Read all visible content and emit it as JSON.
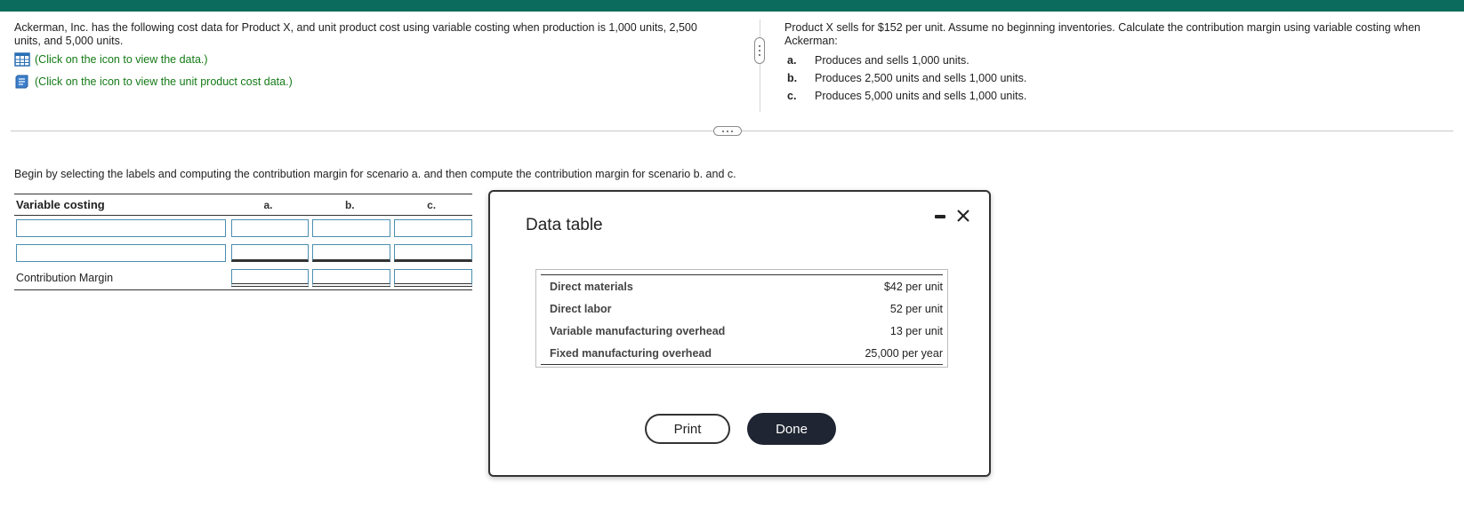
{
  "question": {
    "intro": "Ackerman, Inc. has the following cost data for Product X, and unit product cost using variable costing when production is 1,000 units, 2,500 units, and 5,000 units.",
    "link_data": "(Click on the icon to view the data.)",
    "link_unit_cost": "(Click on the icon to view the unit product cost data.)",
    "right_text": "Product X sells for $152 per unit. Assume no beginning inventories. Calculate the contribution margin using variable costing when Ackerman:",
    "scenarios": [
      {
        "letter": "a.",
        "text": "Produces and sells 1,000 units."
      },
      {
        "letter": "b.",
        "text": "Produces 2,500 units and sells 1,000 units."
      },
      {
        "letter": "c.",
        "text": "Produces 5,000 units and sells 1,000 units."
      }
    ]
  },
  "instruction": "Begin by selecting the labels and computing the contribution margin for scenario a. and then compute the contribution margin for scenario b. and c.",
  "vc_table": {
    "title": "Variable costing",
    "col_a": "a.",
    "col_b": "b.",
    "col_c": "c.",
    "row3_label": "Contribution Margin"
  },
  "modal": {
    "title": "Data table",
    "rows": [
      {
        "label": "Direct materials",
        "value": "$42 per unit"
      },
      {
        "label": "Direct labor",
        "value": "52 per unit"
      },
      {
        "label": "Variable manufacturing overhead",
        "value": "13 per unit"
      },
      {
        "label": "Fixed manufacturing overhead",
        "value": "25,000 per year"
      }
    ],
    "print_label": "Print",
    "done_label": "Done"
  },
  "colors": {
    "topbar": "#0b6b5c",
    "link": "#137a16",
    "input_border": "#4b8eb0",
    "done_button": "#1f2532"
  }
}
